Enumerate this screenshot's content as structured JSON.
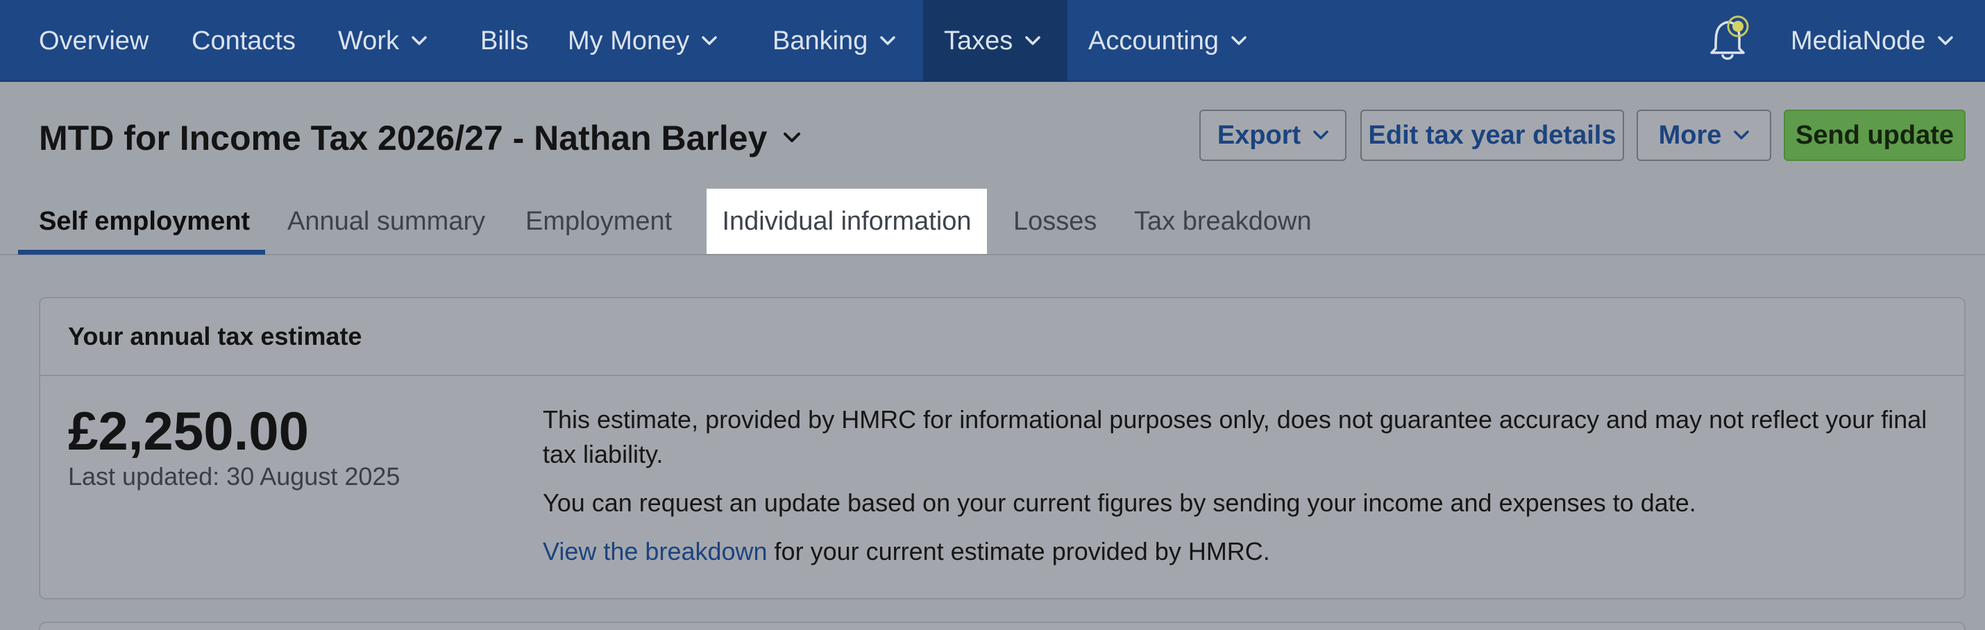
{
  "nav": {
    "items": [
      {
        "label": "Overview",
        "dropdown": false,
        "active": false
      },
      {
        "label": "Contacts",
        "dropdown": false,
        "active": false
      },
      {
        "label": "Work",
        "dropdown": true,
        "active": false
      },
      {
        "label": "Bills",
        "dropdown": false,
        "active": false
      },
      {
        "label": "My Money",
        "dropdown": true,
        "active": false
      },
      {
        "label": "Banking",
        "dropdown": true,
        "active": false
      },
      {
        "label": "Taxes",
        "dropdown": true,
        "active": true
      },
      {
        "label": "Accounting",
        "dropdown": true,
        "active": false
      }
    ],
    "notification_icon": "bell-icon",
    "user": "MediaNode"
  },
  "header": {
    "title": "MTD for Income Tax 2026/27 - Nathan Barley",
    "buttons": {
      "export": "Export",
      "edit": "Edit tax year details",
      "more": "More",
      "send": "Send update"
    }
  },
  "tabs": [
    {
      "label": "Self employment",
      "active": true
    },
    {
      "label": "Annual summary",
      "active": false
    },
    {
      "label": "Employment",
      "active": false
    },
    {
      "label": "Individual information",
      "active": false,
      "highlighted": true
    },
    {
      "label": "Losses",
      "active": false
    },
    {
      "label": "Tax breakdown",
      "active": false
    }
  ],
  "estimate": {
    "heading": "Your annual tax estimate",
    "amount": "£2,250.00",
    "last_updated": "Last updated: 30 August 2025",
    "para1": "This estimate, provided by HMRC for informational purposes only, does not guarantee accuracy and may not reflect your final tax liability.",
    "para2": "You can request an update based on your current figures by sending your income and expenses to date.",
    "link": "View the breakdown",
    "para3_rest": " for your current estimate provided by HMRC."
  },
  "colors": {
    "nav_bg": "#1e4785",
    "accent": "#1c437f",
    "primary_button": "#5e9b4a",
    "highlight": "#ffffff"
  }
}
